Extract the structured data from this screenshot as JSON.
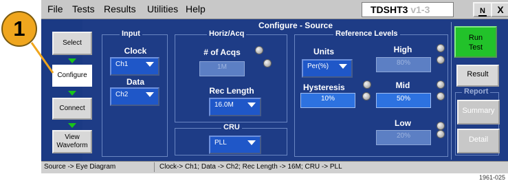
{
  "menu": {
    "items": [
      "File",
      "Tests",
      "Results",
      "Utilities",
      "Help"
    ]
  },
  "app": {
    "name": "TDSHT3",
    "version": "v1-3"
  },
  "window_buttons": {
    "minimize_label": "N",
    "close_label": "X"
  },
  "page_title": "Configure - Source",
  "steps": [
    {
      "label": "Select"
    },
    {
      "label": "Configure"
    },
    {
      "label": "Connect"
    },
    {
      "label": "View Waveform"
    }
  ],
  "input": {
    "title": "Input",
    "clock_label": "Clock",
    "clock_value": "Ch1",
    "data_label": "Data",
    "data_value": "Ch2"
  },
  "horiz": {
    "title": "Horiz/Acq",
    "acqs_label": "# of Acqs",
    "acqs_value": "1M",
    "rec_length_label": "Rec Length",
    "rec_length_value": "16.0M"
  },
  "cru": {
    "title": "CRU",
    "value": "PLL"
  },
  "reference": {
    "title": "Reference Levels",
    "units_label": "Units",
    "units_value": "Per(%)",
    "hysteresis_label": "Hysteresis",
    "hysteresis_value": "10%",
    "high_label": "High",
    "high_value": "80%",
    "mid_label": "Mid",
    "mid_value": "50%",
    "low_label": "Low",
    "low_value": "20%"
  },
  "actions": {
    "run_label": "Run Test",
    "result_label": "Result",
    "report_title": "Report",
    "summary_label": "Summary",
    "detail_label": "Detail"
  },
  "status": {
    "left": "Source -> Eye Diagram",
    "right": "Clock-> Ch1; Data -> Ch2; Rec Length -> 16M; CRU -> PLL"
  },
  "callout": "1",
  "figure_id": "1961-025",
  "colors": {
    "panel": "#1e3c86",
    "run": "#22c22a",
    "callout": "#f0a61e",
    "arrow": "#19c419"
  },
  "icons": [
    "dropdown-arrow-icon",
    "adjust-knob-icon",
    "down-arrow-icon",
    "minimize-icon",
    "close-icon"
  ]
}
